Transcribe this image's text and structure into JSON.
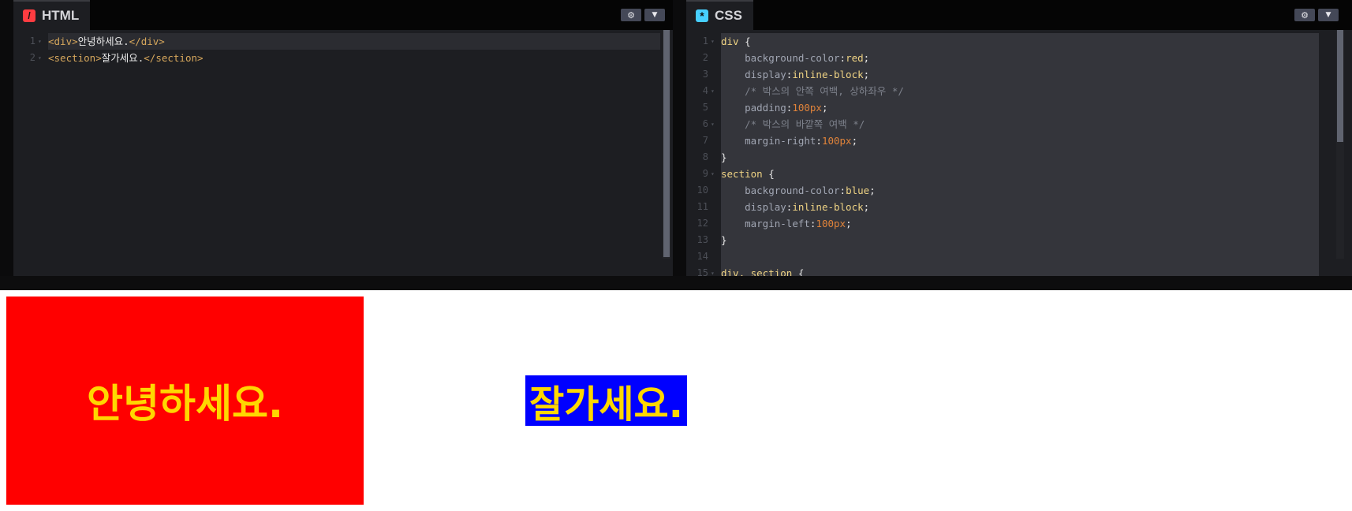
{
  "html_panel": {
    "title": "HTML",
    "icon": "/",
    "icon_color": "#ff3c41",
    "lines": [
      {
        "n": "1",
        "fold": "▾",
        "tokens": [
          {
            "c": "t-tag",
            "t": "<div>"
          },
          {
            "c": "t-pl",
            "t": "안녕하세요."
          },
          {
            "c": "t-tag",
            "t": "</div>"
          }
        ]
      },
      {
        "n": "2",
        "fold": "▾",
        "tokens": [
          {
            "c": "t-tag",
            "t": "<section>"
          },
          {
            "c": "t-pl",
            "t": "잘가세요."
          },
          {
            "c": "t-tag",
            "t": "</section>"
          }
        ]
      }
    ]
  },
  "css_panel": {
    "title": "CSS",
    "icon": "*",
    "icon_color": "#47cfff",
    "lines": [
      {
        "n": "1",
        "fold": "▾",
        "tokens": [
          {
            "c": "t-sel",
            "t": "div"
          },
          {
            "c": "t-pl",
            "t": " {"
          }
        ]
      },
      {
        "n": "2",
        "fold": "",
        "tokens": [
          {
            "c": "t-pl",
            "t": "    "
          },
          {
            "c": "t-prop",
            "t": "background-color"
          },
          {
            "c": "t-pl",
            "t": ":"
          },
          {
            "c": "t-val",
            "t": "red"
          },
          {
            "c": "t-pl",
            "t": ";"
          }
        ]
      },
      {
        "n": "3",
        "fold": "",
        "tokens": [
          {
            "c": "t-pl",
            "t": "    "
          },
          {
            "c": "t-prop",
            "t": "display"
          },
          {
            "c": "t-pl",
            "t": ":"
          },
          {
            "c": "t-val",
            "t": "inline-block"
          },
          {
            "c": "t-pl",
            "t": ";"
          }
        ]
      },
      {
        "n": "4",
        "fold": "▾",
        "tokens": [
          {
            "c": "t-pl",
            "t": "    "
          },
          {
            "c": "t-com",
            "t": "/* 박스의 안쪽 여백, 상하좌우 */"
          }
        ]
      },
      {
        "n": "5",
        "fold": "",
        "tokens": [
          {
            "c": "t-pl",
            "t": "    "
          },
          {
            "c": "t-prop",
            "t": "padding"
          },
          {
            "c": "t-pl",
            "t": ":"
          },
          {
            "c": "t-num",
            "t": "100px"
          },
          {
            "c": "t-pl",
            "t": ";"
          }
        ]
      },
      {
        "n": "6",
        "fold": "▾",
        "tokens": [
          {
            "c": "t-pl",
            "t": "    "
          },
          {
            "c": "t-com",
            "t": "/* 박스의 바깥쪽 여백 */"
          }
        ]
      },
      {
        "n": "7",
        "fold": "",
        "tokens": [
          {
            "c": "t-pl",
            "t": "    "
          },
          {
            "c": "t-prop",
            "t": "margin-right"
          },
          {
            "c": "t-pl",
            "t": ":"
          },
          {
            "c": "t-num",
            "t": "100px"
          },
          {
            "c": "t-pl",
            "t": ";"
          }
        ]
      },
      {
        "n": "8",
        "fold": "",
        "tokens": [
          {
            "c": "t-pl",
            "t": "}"
          }
        ]
      },
      {
        "n": "9",
        "fold": "▾",
        "tokens": [
          {
            "c": "t-sel",
            "t": "section"
          },
          {
            "c": "t-pl",
            "t": " {"
          }
        ]
      },
      {
        "n": "10",
        "fold": "",
        "tokens": [
          {
            "c": "t-pl",
            "t": "    "
          },
          {
            "c": "t-prop",
            "t": "background-color"
          },
          {
            "c": "t-pl",
            "t": ":"
          },
          {
            "c": "t-val",
            "t": "blue"
          },
          {
            "c": "t-pl",
            "t": ";"
          }
        ]
      },
      {
        "n": "11",
        "fold": "",
        "tokens": [
          {
            "c": "t-pl",
            "t": "    "
          },
          {
            "c": "t-prop",
            "t": "display"
          },
          {
            "c": "t-pl",
            "t": ":"
          },
          {
            "c": "t-val",
            "t": "inline-block"
          },
          {
            "c": "t-pl",
            "t": ";"
          }
        ]
      },
      {
        "n": "12",
        "fold": "",
        "tokens": [
          {
            "c": "t-pl",
            "t": "    "
          },
          {
            "c": "t-prop",
            "t": "margin-left"
          },
          {
            "c": "t-pl",
            "t": ":"
          },
          {
            "c": "t-num",
            "t": "100px"
          },
          {
            "c": "t-pl",
            "t": ";"
          }
        ]
      },
      {
        "n": "13",
        "fold": "",
        "tokens": [
          {
            "c": "t-pl",
            "t": "}"
          }
        ]
      },
      {
        "n": "14",
        "fold": "",
        "tokens": []
      },
      {
        "n": "15",
        "fold": "▾",
        "tokens": [
          {
            "c": "t-sel",
            "t": "div, section"
          },
          {
            "c": "t-pl",
            "t": " {"
          }
        ]
      }
    ]
  },
  "controls": {
    "settings_icon": "gear-icon",
    "settings_glyph": "⚙",
    "collapse_icon": "chevron-down-icon",
    "collapse_glyph": "▼"
  },
  "preview": {
    "div_text": "안녕하세요.",
    "section_text": "잘가세요.",
    "div_color": "#ff0000",
    "section_color": "#0000ff",
    "text_color": "#ffd700"
  }
}
